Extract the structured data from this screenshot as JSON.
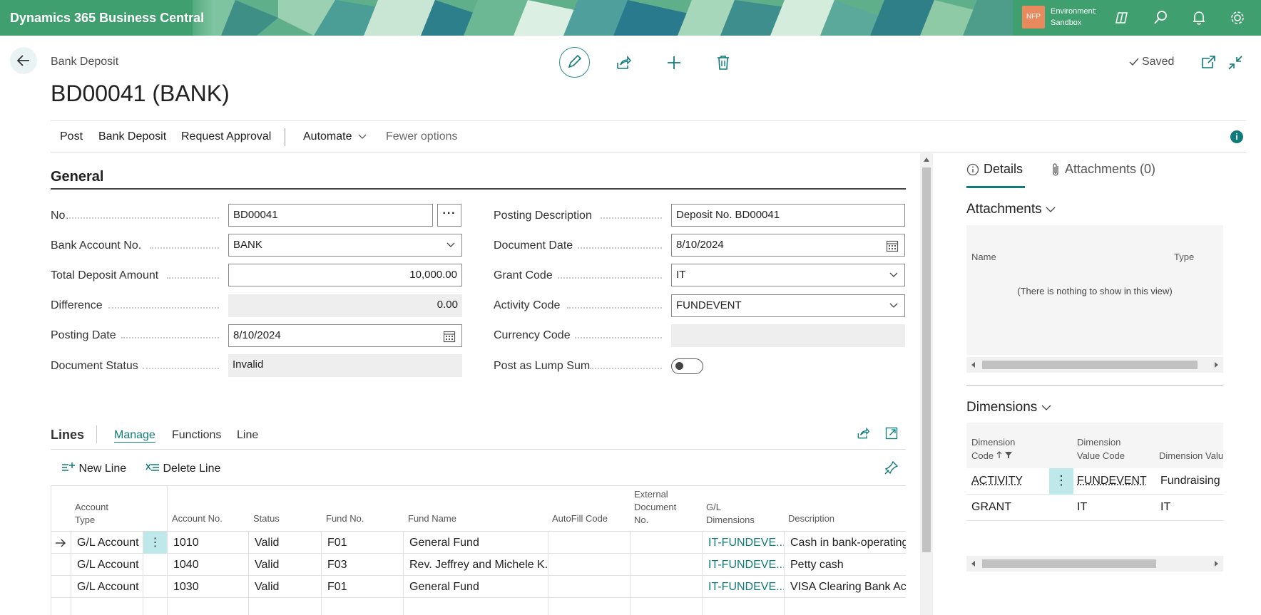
{
  "app": {
    "title": "Dynamics 365 Business Central",
    "environment_badge": "NFP",
    "environment_label": "Environment:",
    "environment_name": "Sandbox",
    "brand_color": "#3f9f6f",
    "accent_color": "#0f7b7b"
  },
  "header": {
    "breadcrumb": "Bank Deposit",
    "title": "BD00041 (BANK)",
    "saved_label": "Saved"
  },
  "actions": {
    "post": "Post",
    "bank_deposit": "Bank Deposit",
    "request_approval": "Request Approval",
    "automate": "Automate",
    "fewer_options": "Fewer options"
  },
  "general": {
    "title": "General",
    "no": {
      "label": "No.",
      "value": "BD00041"
    },
    "bank_account_no": {
      "label": "Bank Account No.",
      "value": "BANK"
    },
    "total_deposit_amount": {
      "label": "Total Deposit Amount",
      "value": "10,000.00"
    },
    "difference": {
      "label": "Difference",
      "value": "0.00"
    },
    "posting_date": {
      "label": "Posting Date",
      "value": "8/10/2024"
    },
    "document_status": {
      "label": "Document Status",
      "value": "Invalid"
    },
    "posting_description": {
      "label": "Posting Description",
      "value": "Deposit No. BD00041"
    },
    "document_date": {
      "label": "Document Date",
      "value": "8/10/2024"
    },
    "grant_code": {
      "label": "Grant Code",
      "value": "IT"
    },
    "activity_code": {
      "label": "Activity Code",
      "value": "FUNDEVENT"
    },
    "currency_code": {
      "label": "Currency Code",
      "value": ""
    },
    "post_as_lump_sum": {
      "label": "Post as Lump Sum",
      "value": false
    }
  },
  "lines": {
    "title": "Lines",
    "tabs": [
      "Manage",
      "Functions",
      "Line"
    ],
    "new_line": "New Line",
    "delete_line": "Delete Line",
    "columns": {
      "account_type": [
        "Account",
        "Type"
      ],
      "account_no": "Account No.",
      "status": "Status",
      "fund_no": "Fund No.",
      "fund_name": "Fund Name",
      "autofill_code": "AutoFill Code",
      "external_document_no": [
        "External",
        "Document",
        "No."
      ],
      "gl_dimensions": [
        "G/L",
        "Dimensions"
      ],
      "description": "Description"
    },
    "rows": [
      {
        "account_type": "G/L Account",
        "account_no": "1010",
        "status": "Valid",
        "fund_no": "F01",
        "fund_name": "General Fund",
        "autofill_code": "",
        "external_document_no": "",
        "gl_dimensions": "IT-FUNDEVE...",
        "description": "Cash in bank-operating"
      },
      {
        "account_type": "G/L Account",
        "account_no": "1040",
        "status": "Valid",
        "fund_no": "F03",
        "fund_name": "Rev. Jeffrey and Michele K...",
        "autofill_code": "",
        "external_document_no": "",
        "gl_dimensions": "IT-FUNDEVE...",
        "description": "Petty cash"
      },
      {
        "account_type": "G/L Account",
        "account_no": "1030",
        "status": "Valid",
        "fund_no": "F01",
        "fund_name": "General Fund",
        "autofill_code": "",
        "external_document_no": "",
        "gl_dimensions": "IT-FUNDEVE...",
        "description": "VISA Clearing Bank Acco"
      }
    ]
  },
  "factbox": {
    "tab_details": "Details",
    "tab_attachments": "Attachments (0)",
    "attachments": {
      "title": "Attachments",
      "col_name": "Name",
      "col_type": "Type",
      "empty": "(There is nothing to show in this view)"
    },
    "dimensions": {
      "title": "Dimensions",
      "col_code": [
        "Dimension",
        "Code"
      ],
      "col_value_code": [
        "Dimension",
        "Value Code"
      ],
      "col_value": "Dimension Valu",
      "rows": [
        {
          "code": "ACTIVITY",
          "value_code": "FUNDEVENT",
          "value": "Fundraising E"
        },
        {
          "code": "GRANT",
          "value_code": "IT",
          "value": "IT"
        }
      ]
    }
  }
}
